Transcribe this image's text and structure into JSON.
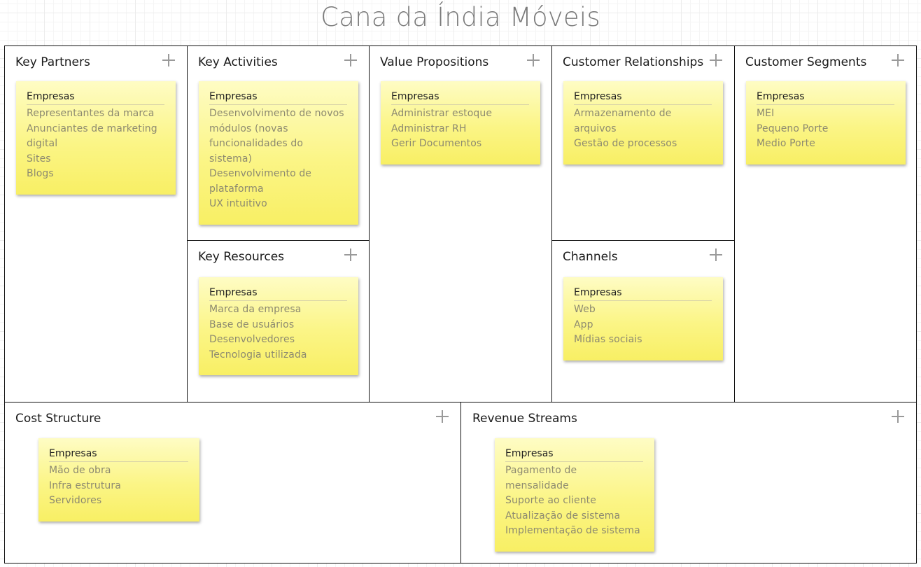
{
  "canvas": {
    "title": "Cana da Índia Móveis"
  },
  "blocks": {
    "key_partners": {
      "title": "Key Partners",
      "note": {
        "heading": "Empresas",
        "items": [
          "Representantes da marca",
          "Anunciantes de marketing digital",
          "Sites",
          "Blogs"
        ]
      }
    },
    "key_activities": {
      "title": "Key Activities",
      "note": {
        "heading": "Empresas",
        "items": [
          "Desenvolvimento de novos módulos (novas funcionalidades do sistema)",
          "Desenvolvimento de plataforma",
          "UX intuitivo"
        ]
      }
    },
    "key_resources": {
      "title": "Key Resources",
      "note": {
        "heading": "Empresas",
        "items": [
          "Marca da empresa",
          "Base de usuários",
          "Desenvolvedores",
          "Tecnologia utilizada"
        ]
      }
    },
    "value_propositions": {
      "title": "Value Propositions",
      "note": {
        "heading": "Empresas",
        "items": [
          "Administrar estoque",
          "Administrar RH",
          "Gerir Documentos"
        ]
      }
    },
    "customer_relationships": {
      "title": "Customer Relationships",
      "note": {
        "heading": "Empresas",
        "items": [
          "Armazenamento de arquivos",
          "Gestão de processos"
        ]
      }
    },
    "channels": {
      "title": "Channels",
      "note": {
        "heading": "Empresas",
        "items": [
          "Web",
          "App",
          "Mídias sociais"
        ]
      }
    },
    "customer_segments": {
      "title": "Customer Segments",
      "note": {
        "heading": "Empresas",
        "items": [
          "MEI",
          "Pequeno Porte",
          "Medio Porte"
        ]
      }
    },
    "cost_structure": {
      "title": "Cost Structure",
      "note": {
        "heading": "Empresas",
        "items": [
          "Mão de obra",
          "Infra estrutura",
          "Servidores"
        ]
      }
    },
    "revenue_streams": {
      "title": "Revenue Streams",
      "note": {
        "heading": "Empresas",
        "items": [
          "Pagamento de mensalidade",
          "Suporte ao cliente",
          "Atualização de sistema",
          "Implementação de sistema"
        ]
      }
    }
  },
  "colors": {
    "note_top": "#fefcc4",
    "note_bottom": "#f8ef64",
    "border": "#111111",
    "title_text": "#7a7a7a"
  },
  "icons": {
    "add": "plus-icon"
  }
}
